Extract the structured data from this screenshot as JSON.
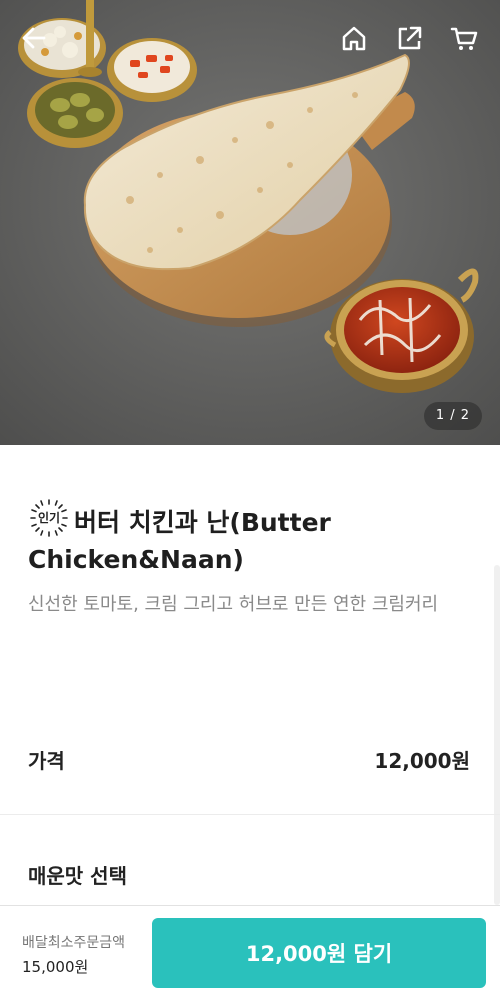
{
  "hero": {
    "page_indicator": "1 / 2"
  },
  "topbar": {
    "back_icon": "arrow-left-icon",
    "home_icon": "home-icon",
    "share_icon": "share-icon",
    "cart_icon": "cart-icon"
  },
  "menu": {
    "badge": "인기",
    "title": "버터 치킨과 난(Butter Chicken&Naan)",
    "description": "신선한 토마토, 크림 그리고 허브로 만든 연한 크림커리"
  },
  "price": {
    "label": "가격",
    "value": "12,000원"
  },
  "options": {
    "spicy_title": "매운맛 선택"
  },
  "bottom_bar": {
    "min_order_label": "배달최소주문금액",
    "min_order_value": "15,000원",
    "add_button_label": "12,000원 담기"
  },
  "colors": {
    "accent": "#2ac1bc",
    "background_surface": "#5d5d5b"
  }
}
